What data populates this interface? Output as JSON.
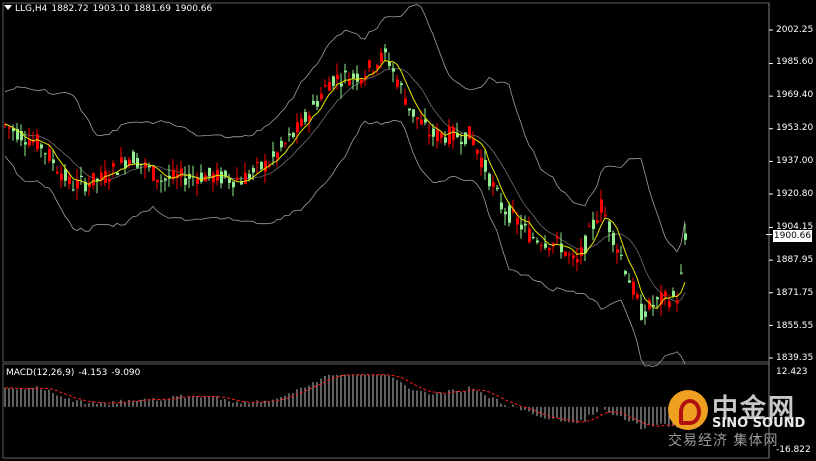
{
  "header": {
    "symbol": "LLG,H4",
    "open": "1882.72",
    "high": "1903.10",
    "low": "1881.69",
    "close": "1900.66"
  },
  "price_axis": {
    "labels": [
      "2002.25",
      "1985.60",
      "1969.40",
      "1953.20",
      "1937.00",
      "1920.80",
      "1904.15",
      "1887.95",
      "1871.75",
      "1855.55",
      "1839.35"
    ],
    "current_price": "1900.66"
  },
  "macd": {
    "title": "MACD(12,26,9)",
    "main": "-4.153",
    "signal": "-9.090",
    "axis_top": "12.423",
    "axis_bottom": "-16.822"
  },
  "watermark": {
    "brand_cn": "中金网",
    "brand_en": "SINO SOUND",
    "slogan": "交易经济 集体网"
  },
  "colors": {
    "bull": "#ff0000",
    "bear": "#90ee90",
    "signal_line": "#ff0000",
    "ma_line": "#ffff00",
    "bands": "#a0a0a0",
    "macd_hist": "#c0c0c0"
  }
}
